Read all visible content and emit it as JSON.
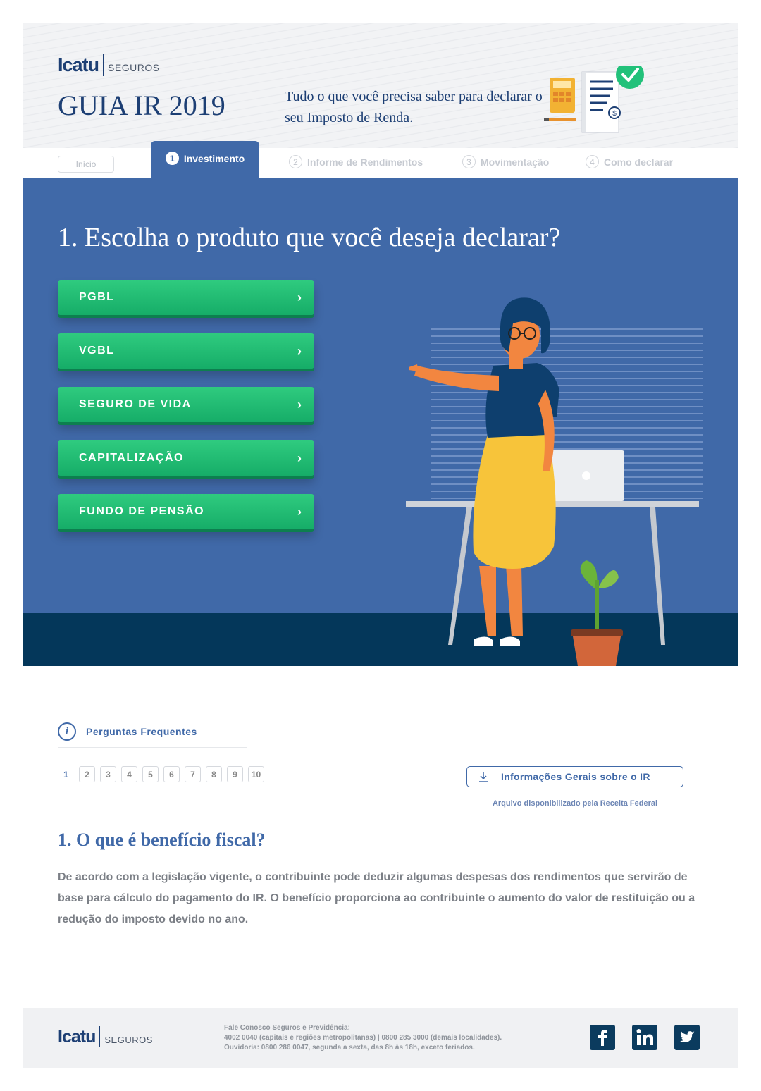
{
  "header": {
    "logo_brand": "Icatu",
    "logo_sub": "SEGUROS",
    "title": "GUIA IR 2019",
    "subtitle": "Tudo o que você precisa saber para declarar o seu Imposto de Renda."
  },
  "tabs": [
    {
      "label": "Início"
    },
    {
      "num": "1",
      "label": "Investimento",
      "active": true
    },
    {
      "num": "2",
      "label": "Informe de Rendimentos"
    },
    {
      "num": "3",
      "label": "Movimentação"
    },
    {
      "num": "4",
      "label": "Como declarar"
    }
  ],
  "hero": {
    "question": "1. Escolha o produto que você deseja declarar?",
    "products": [
      "PGBL",
      "VGBL",
      "SEGURO DE VIDA",
      "CAPITALIZAÇÃO",
      "FUNDO DE PENSÃO"
    ]
  },
  "faq": {
    "label": "Perguntas Frequentes",
    "pages": [
      "1",
      "2",
      "3",
      "4",
      "5",
      "6",
      "7",
      "8",
      "9",
      "10"
    ],
    "current_page": "1",
    "download_label": "Informações Gerais sobre o IR",
    "download_note": "Arquivo disponibilizado pela Receita Federal",
    "question_title": "1. O que é benefício fiscal?",
    "question_body": "De acordo com a legislação vigente, o contribuinte pode deduzir algumas despesas dos rendimentos que servirão de base para cálculo do pagamento do IR. O benefício proporciona ao contribuinte o aumento do valor de restituição ou a redução do imposto devido no ano."
  },
  "footer": {
    "logo_brand": "Icatu",
    "logo_sub": "SEGUROS",
    "line1": "Fale Conosco Seguros e Previdência:",
    "line2": "4002 0040 (capitais e regiões metropolitanas) | 0800 285 3000 (demais localidades).",
    "line3": "Ouvidoria: 0800 286 0047, segunda a sexta, das 8h às 18h, exceto feriados.",
    "social": [
      "facebook-icon",
      "linkedin-icon",
      "twitter-icon"
    ]
  },
  "colors": {
    "primary_blue": "#4069a8",
    "navy": "#1d3f74",
    "green": "#1fbf72",
    "dark_floor": "#04375a"
  }
}
